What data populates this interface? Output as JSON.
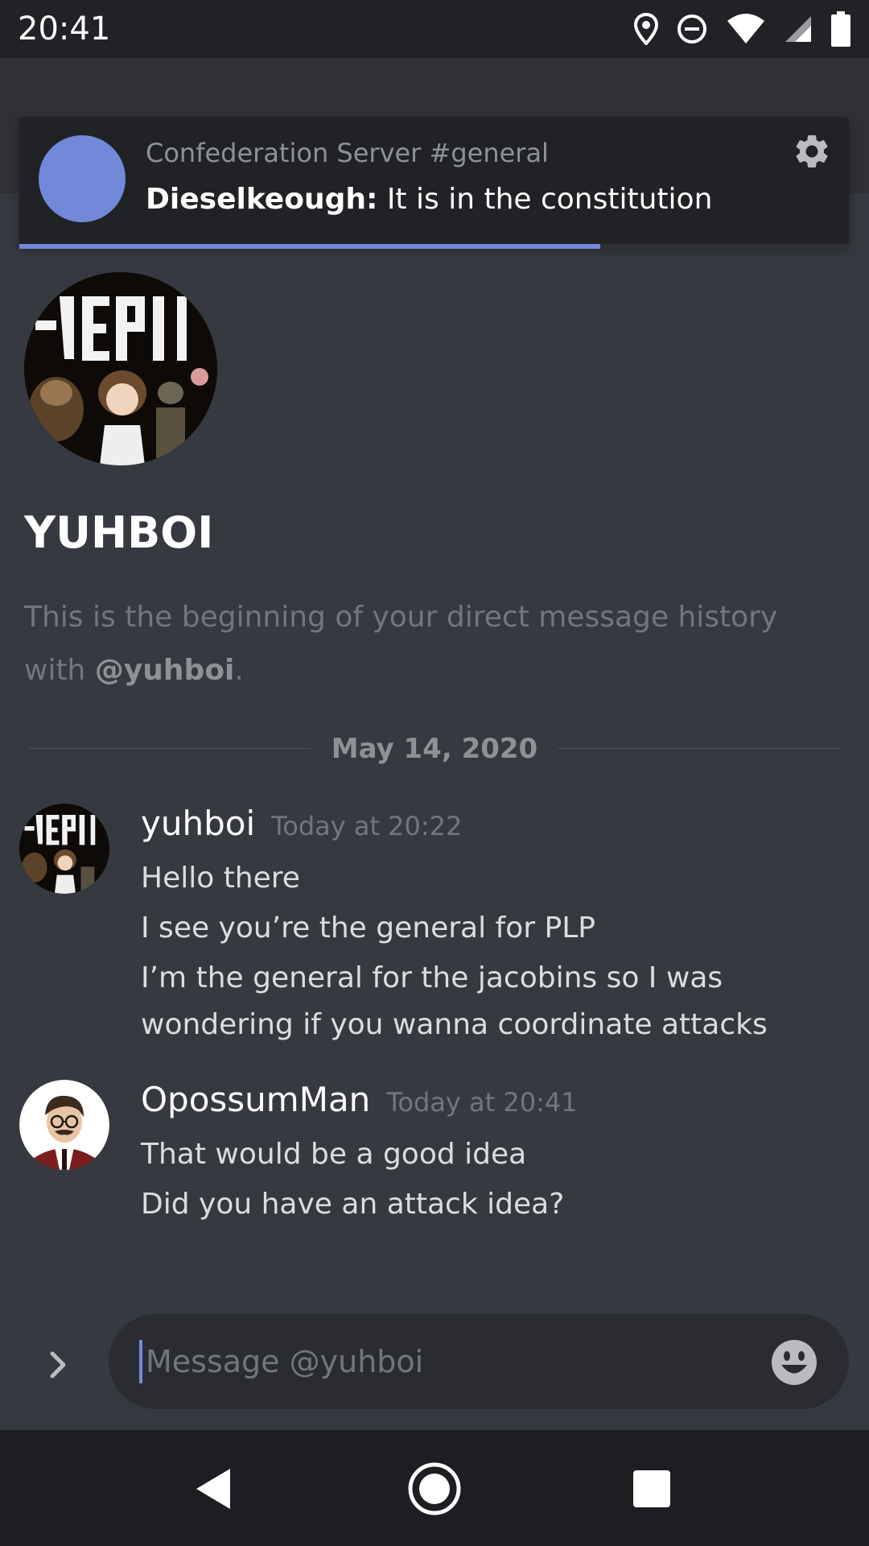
{
  "status_bar": {
    "time": "20:41",
    "icons": [
      "location-icon",
      "do-not-disturb-icon",
      "wifi-icon",
      "signal-icon",
      "battery-icon"
    ]
  },
  "notification": {
    "source": "Confederation Server #general",
    "sender": "Dieselkeough:",
    "text": " It is in the constitution",
    "progress": 0.7
  },
  "profile": {
    "name": "YUHBOI",
    "intro_text": "This is the beginning of your direct message history with ",
    "intro_mention": "@yuhboi",
    "intro_end": "."
  },
  "date_divider": "May 14, 2020",
  "messages": [
    {
      "author": "yuhboi",
      "time": "Today at 20:22",
      "lines": [
        "Hello there",
        "I see you’re the general for PLP",
        "I’m the general for the jacobins so I was wondering if you wanna coordinate attacks"
      ]
    },
    {
      "author": "OpossumMan",
      "time": "Today at 20:41",
      "lines": [
        "That would be a good idea",
        "Did you have an attack idea?"
      ]
    }
  ],
  "composer": {
    "placeholder": "Message @yuhboi"
  },
  "colors": {
    "accent": "#7289da",
    "background": "#36393f",
    "header": "#2f3136",
    "notification": "#202225"
  }
}
